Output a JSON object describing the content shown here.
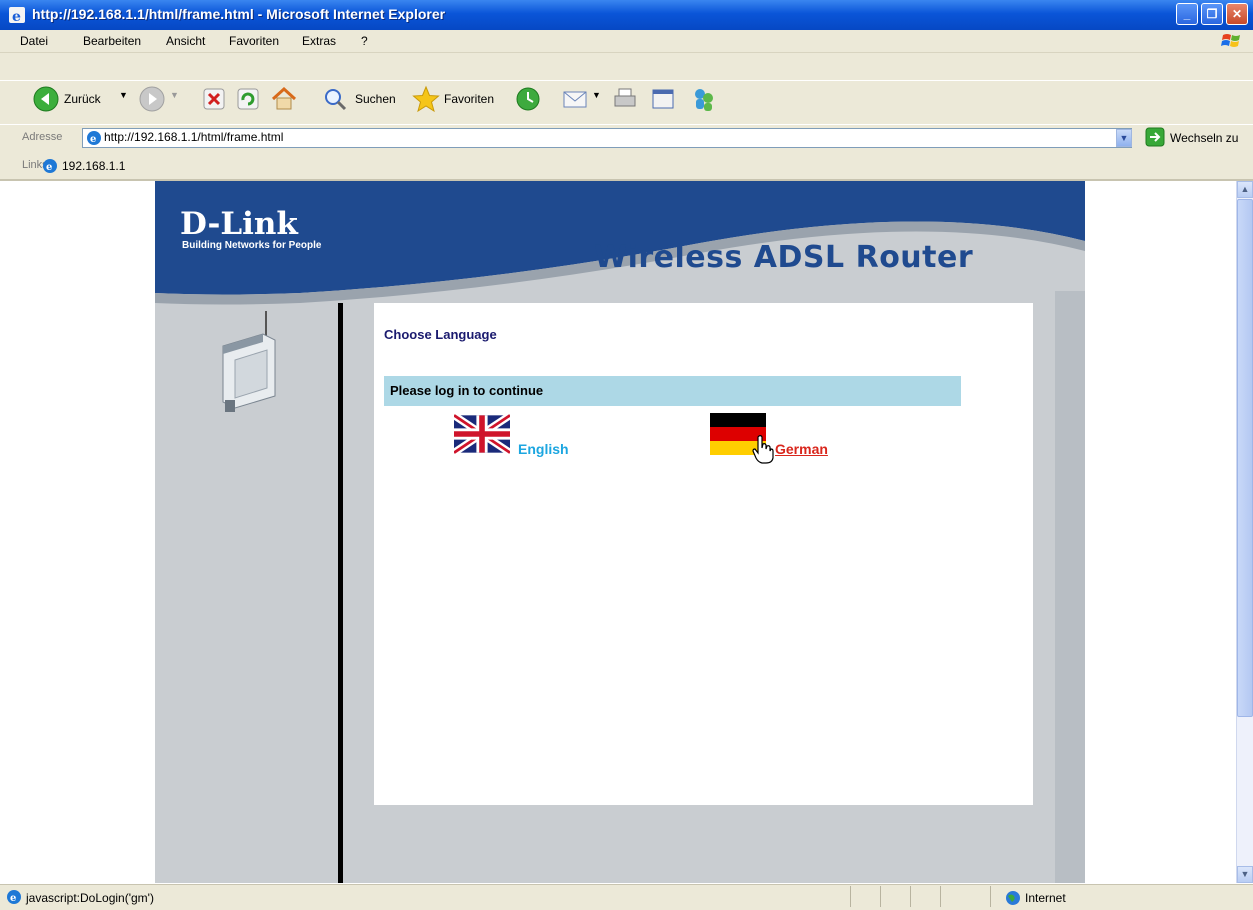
{
  "window": {
    "title": "http://192.168.1.1/html/frame.html - Microsoft Internet Explorer"
  },
  "menu": {
    "items": [
      "Datei",
      "Bearbeiten",
      "Ansicht",
      "Favoriten",
      "Extras",
      "?"
    ]
  },
  "toolbar": {
    "back_label": "Zurück",
    "search_label": "Suchen",
    "favorites_label": "Favoriten"
  },
  "address": {
    "label": "Adresse",
    "value": "http://192.168.1.1/html/frame.html",
    "go_label": "Wechseln zu"
  },
  "links": {
    "label": "Links",
    "item": "192.168.1.1"
  },
  "router_page": {
    "brand": "D-Link",
    "slogan": "Building Networks for People",
    "product_title": "Wireless ADSL Router",
    "choose_language": "Choose Language",
    "login_prompt": "Please log in to continue",
    "languages": [
      {
        "label": "English",
        "flag": "uk-flag-icon"
      },
      {
        "label": "German",
        "flag": "germany-flag-icon"
      }
    ]
  },
  "status": {
    "text": "javascript:DoLogin('gm')",
    "zone": "Internet"
  },
  "colors": {
    "titlebar": "#0a55d8",
    "router_blue": "#1f4a8f",
    "login_bar": "#add8e6",
    "english_link": "#1ca6e0",
    "german_link": "#d9261c"
  }
}
